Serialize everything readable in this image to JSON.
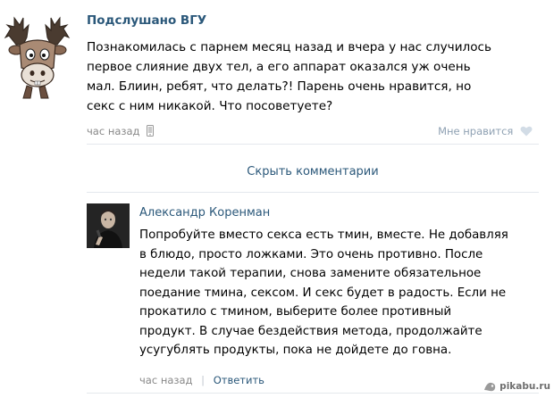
{
  "post": {
    "author": "Подслушано ВГУ",
    "text_lines": [
      "Познакомилась с парнем месяц назад и вчера у нас случилось",
      "первое слияние двух тел, а его аппарат оказался уж очень",
      "мал. Блиин, ребят, что делать?! Парень очень нравится, но",
      "секс с ним никакой. Что посоветуете?"
    ],
    "time": "час назад",
    "like_label": "Мне нравится"
  },
  "comments_toggle": "Скрыть комментарии",
  "comment": {
    "author": "Александр Коренман",
    "text_lines": [
      "Попробуйте вместо секса есть тмин, вместе. Не добавляя",
      "в блюдо, просто ложками. Это очень противно. После",
      "недели такой терапии, снова замените обязательное",
      "поедание тмина, сексом. И секс будет в радость. Если не",
      "прокатило с тмином, выберите более противный",
      "продукт. В случае бездействия метода, продолжайте",
      "усугублять продукты, пока не дойдете до говна."
    ],
    "time": "час назад",
    "reply_label": "Ответить"
  },
  "watermark": "pikabu.ru",
  "colors": {
    "link": "#2b587a",
    "meta": "#888888",
    "like": "#8fa1b3",
    "divider": "#e4e8ed"
  },
  "icons": {
    "post_avatar": "moose-with-antlers-avatar",
    "time_device": "mobile-phone-icon",
    "like": "heart-icon",
    "watermark": "pikabu-logo"
  }
}
